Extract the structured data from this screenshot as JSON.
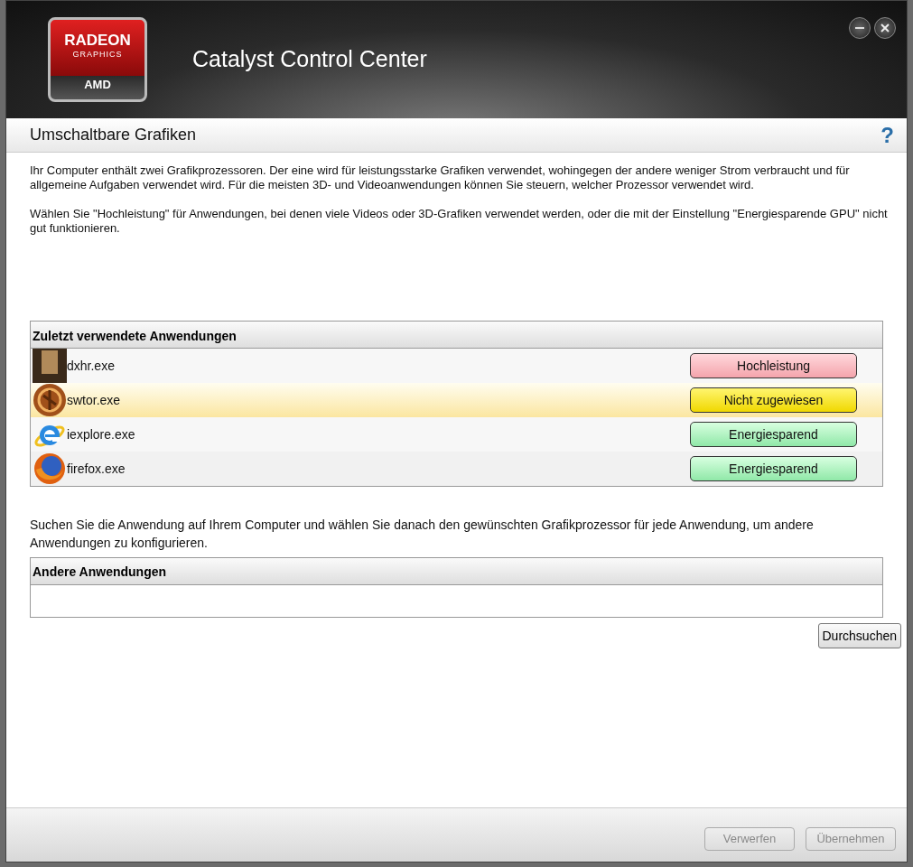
{
  "window": {
    "title": "Catalyst Control Center",
    "logo": {
      "line_1": "RADEON",
      "line_2": "GRAPHICS",
      "brand": "AMD"
    }
  },
  "page": {
    "title": "Umschaltbare Grafiken",
    "help": "?"
  },
  "intro": [
    "Ihr Computer enthält zwei Grafikprozessoren. Der eine wird für leistungsstarke Grafiken verwendet, wohingegen der andere weniger Strom verbraucht und für allgemeine Aufgaben verwendet wird. Für die meisten 3D- und Videoanwendungen können Sie steuern, welcher Prozessor verwendet wird.",
    "Wählen Sie \"Hochleistung\" für Anwendungen, bei denen viele Videos oder 3D-Grafiken verwendet werden, oder die mit der Einstellung \"Energiesparende GPU\" nicht gut funktionieren."
  ],
  "recent": {
    "title": "Zuletzt verwendete Anwendungen",
    "rows": [
      {
        "name": "dxhr.exe",
        "kind": "high",
        "setting": "Hochleistung",
        "selected": false
      },
      {
        "name": "swtor.exe",
        "kind": "unassigned",
        "setting": "Nicht zugewiesen",
        "selected": true
      },
      {
        "name": "iexplore.exe",
        "kind": "power",
        "setting": "Energiesparend",
        "selected": false
      },
      {
        "name": "firefox.exe",
        "kind": "power",
        "setting": "Energiesparend",
        "selected": false
      }
    ]
  },
  "other_hint": "Suchen Sie die Anwendung auf Ihrem Computer und wählen Sie danach den gewünschten Grafikprozessor für jede Anwendung, um andere Anwendungen zu konfigurieren.",
  "other": {
    "title": "Andere Anwendungen",
    "browse": "Durchsuchen"
  },
  "footer": [
    {
      "label": "Verwerfen",
      "disabled": true
    },
    {
      "label": "Übernehmen",
      "disabled": true
    }
  ]
}
